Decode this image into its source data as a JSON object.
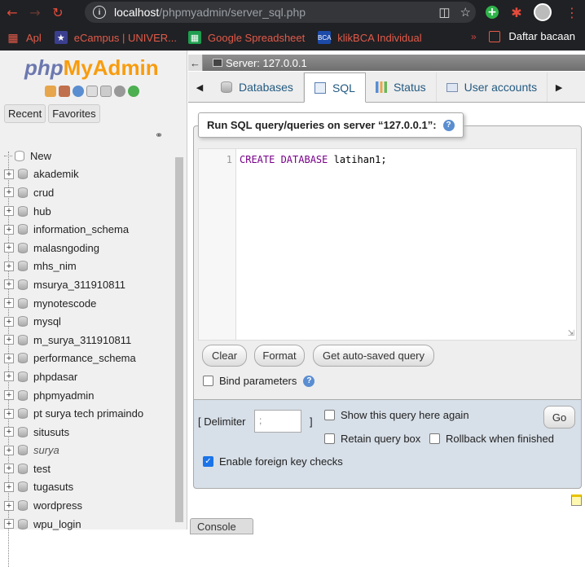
{
  "browser": {
    "url_host": "localhost",
    "url_path": "/phpmyadmin/server_sql.php",
    "bookmarks": [
      {
        "label": "Apl",
        "icon": "apps-grid-icon"
      },
      {
        "label": "eCampus | UNIVER...",
        "icon": "campus-icon"
      },
      {
        "label": "Google Spreadsheet",
        "icon": "sheets-icon"
      },
      {
        "label": "klikBCA Individual",
        "icon": "bca-icon"
      }
    ],
    "reading_list": "Daftar bacaan",
    "colors": {
      "chrome_bg": "#202124",
      "bookmark_text": "#e25a4a"
    }
  },
  "sidebar": {
    "logo": {
      "php": "php",
      "my": "My",
      "admin": "Admin"
    },
    "tabs": [
      "Recent",
      "Favorites"
    ],
    "databases": [
      {
        "name": "New",
        "new": true
      },
      {
        "name": "akademik"
      },
      {
        "name": "crud"
      },
      {
        "name": "hub"
      },
      {
        "name": "information_schema"
      },
      {
        "name": "malasngoding"
      },
      {
        "name": "mhs_nim"
      },
      {
        "name": "msurya_311910811"
      },
      {
        "name": "mynotescode"
      },
      {
        "name": "mysql"
      },
      {
        "name": "m_surya_311910811"
      },
      {
        "name": "performance_schema"
      },
      {
        "name": "phpdasar"
      },
      {
        "name": "phpmyadmin"
      },
      {
        "name": "pt surya tech primaindo"
      },
      {
        "name": "situsuts"
      },
      {
        "name": "surya",
        "italic": true
      },
      {
        "name": "test"
      },
      {
        "name": "tugasuts"
      },
      {
        "name": "wordpress"
      },
      {
        "name": "wpu_login"
      }
    ]
  },
  "main": {
    "server_label": "Server: 127.0.0.1",
    "tabs": [
      {
        "label": "Databases",
        "active": false
      },
      {
        "label": "SQL",
        "active": true
      },
      {
        "label": "Status",
        "active": false
      },
      {
        "label": "User accounts",
        "active": false
      }
    ],
    "legend": "Run SQL query/queries on server “127.0.0.1”:",
    "editor": {
      "line_number": "1",
      "keyword": "CREATE DATABASE",
      "identifier": " latihan1;"
    },
    "buttons": {
      "clear": "Clear",
      "format": "Format",
      "get_autosaved": "Get auto-saved query",
      "go": "Go"
    },
    "bind_params": "Bind parameters",
    "delimiter_label_open": "[ Delimiter",
    "delimiter_label_close": "]",
    "delimiter_value": ";",
    "show_query": "Show this query here again",
    "retain_box": "Retain query box",
    "rollback": "Rollback when finished",
    "foreign_keys": "Enable foreign key checks",
    "foreign_keys_checked": true,
    "console": "Console"
  }
}
